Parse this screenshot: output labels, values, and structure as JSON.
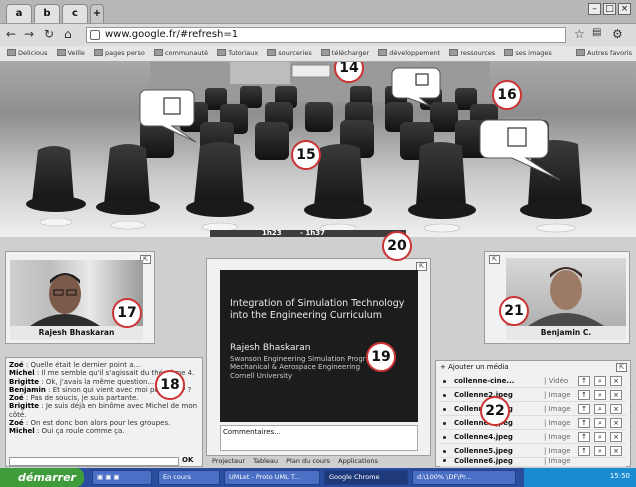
{
  "browser": {
    "url": "www.google.fr/#refresh=1",
    "tabs": [
      "a",
      "b",
      "c"
    ],
    "bookmarks": [
      "Delicious",
      "Veille",
      "pages perso",
      "communauté",
      "Tutoriaux",
      "sourceries",
      "télécharger",
      "développement",
      "ressources",
      "ses images"
    ],
    "bookmarks_right": "Autres favoris"
  },
  "scene": {
    "callouts": {
      "n14": "14",
      "n15": "15",
      "n16": "16",
      "n20": "20"
    },
    "timeline_left": "1h23",
    "timeline_right": "- 1h37"
  },
  "left_cam": {
    "label": "Rajesh Bhaskaran",
    "callout": "17"
  },
  "right_cam": {
    "label": "Benjamin C.",
    "callout": "21"
  },
  "slide": {
    "title": "Integration of Simulation Technology into the Engineering Curriculum",
    "name": "Rajesh Bhaskaran",
    "line1": "Swanson Engineering Simulation Program",
    "line2": "Mechanical & Aerospace Engineering",
    "line3": "Cornell University",
    "callout": "19",
    "comments": "Commentaires..."
  },
  "chat": {
    "callout": "18",
    "lines": [
      {
        "who": "Zoé",
        "text": "Quelle était le dernier point a..."
      },
      {
        "who": "Michel",
        "text": "Il me semble qu'il s'agissait du théorème 4."
      },
      {
        "who": "Brigitte",
        "text": "Ok, j'avais la même question..."
      },
      {
        "who": "Benjamin",
        "text": "Et sinon qui vient avec moi pour le TP ?"
      },
      {
        "who": "Zoé",
        "text": "Pas de soucis, je suis partante."
      },
      {
        "who": "Brigitte",
        "text": "Je suis déjà en binôme avec Michel de mon côté."
      },
      {
        "who": "Zoé",
        "text": "On est donc bon alors pour les groupes."
      },
      {
        "who": "Michel",
        "text": "Oui ça roule comme ça."
      }
    ],
    "ok": "OK"
  },
  "media": {
    "add_label": "+ Ajouter un média",
    "callout": "22",
    "rows": [
      {
        "name": "collenne-cine...",
        "type": "| Vidéo"
      },
      {
        "name": "Collenne2.jpeg",
        "type": "| Image"
      },
      {
        "name": "Collenne3.jpeg",
        "type": "| Image"
      },
      {
        "name": "Collenne3.jpeg",
        "type": "| Image"
      },
      {
        "name": "Collenne4.jpeg",
        "type": "| Image"
      },
      {
        "name": "Collenne5.jpeg",
        "type": "| Image"
      },
      {
        "name": "Collenne6.jpeg",
        "type": "| Image"
      }
    ]
  },
  "toolbar": [
    "Projecteur",
    "Tableau",
    "Plan du cours",
    "Applications"
  ],
  "taskbar": {
    "start": "démarrer",
    "items": [
      "En cours",
      "UMLet - Proto UML T...",
      "Google Chrome",
      "d:\\100% \\DF\\Pr..."
    ],
    "clock": "15:50"
  }
}
